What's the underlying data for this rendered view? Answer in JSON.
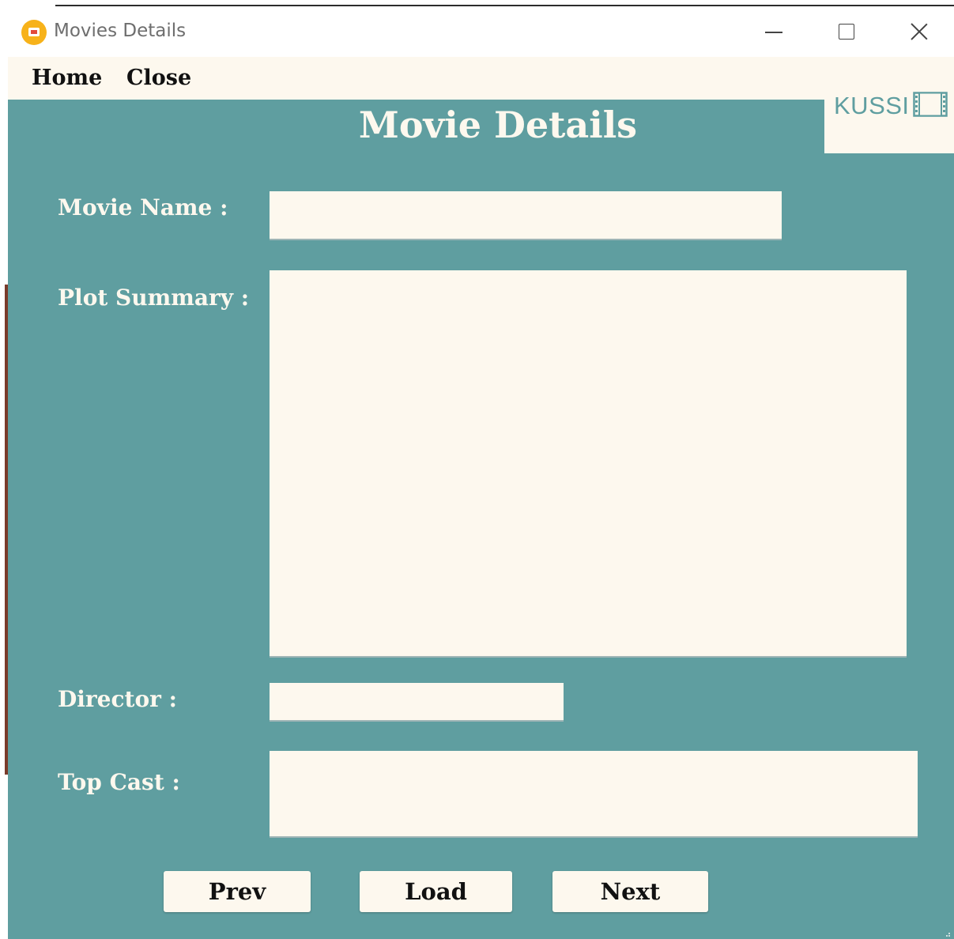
{
  "window": {
    "title": "Movies Details"
  },
  "menu": {
    "home": "Home",
    "close": "Close"
  },
  "logo": {
    "text": "KUSSI"
  },
  "page": {
    "title": "Movie Details"
  },
  "form": {
    "movie_name": {
      "label": "Movie Name :",
      "value": ""
    },
    "plot_summary": {
      "label": "Plot Summary :",
      "value": ""
    },
    "director": {
      "label": "Director :",
      "value": ""
    },
    "top_cast": {
      "label": "Top Cast :",
      "value": ""
    }
  },
  "buttons": {
    "prev": "Prev",
    "load": "Load",
    "next": "Next"
  },
  "colors": {
    "background": "#5f9ea0",
    "field": "#fdf8ee",
    "app_icon": "#f7b21a"
  },
  "icons": {
    "app": "app-icon",
    "logo": "film-icon",
    "minimize": "minimize-icon",
    "maximize": "maximize-icon",
    "close": "close-icon"
  }
}
